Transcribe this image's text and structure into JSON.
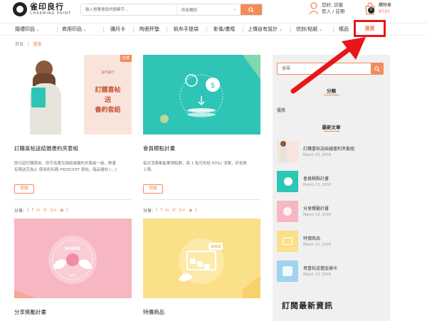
{
  "header": {
    "logo_cn": "雀印良行",
    "logo_en": "CHARMING PRINT",
    "search_placeholder": "輸入想要搜尋的關鍵字...",
    "category_select": "所有類別",
    "user_greeting": "您好, 訪客",
    "user_links": "登入 / 註冊",
    "cart_label": "購物車",
    "cart_price": "NT$0",
    "cart_count": "0"
  },
  "nav": {
    "items": [
      {
        "label": "婚禮印品",
        "caret": "⌄"
      },
      {
        "label": "商用印品",
        "caret": "⌄"
      },
      {
        "label": "彌月卡",
        "caret": ""
      },
      {
        "label": "陶瓷杯墊",
        "caret": ""
      },
      {
        "label": "帆布手提袋",
        "caret": ""
      },
      {
        "label": "影像/畫框",
        "caret": ""
      },
      {
        "label": "上傳自有設計",
        "caret": "⌄"
      },
      {
        "label": "信封/貼紙",
        "caret": "⌄"
      },
      {
        "label": "樣品",
        "caret": ""
      }
    ],
    "active": "優惠"
  },
  "breadcrumb": {
    "home": "首頁",
    "sep": "/",
    "current": "優惠"
  },
  "cards": [
    {
      "title": "訂購喜帖送結婚書約夾套組",
      "excerpt_1": "即日起訂購喜帖，即可免費兌換結婚書約夾套組一組，數量",
      "excerpt_2": "有限送完為止 使用折扣碼 FREECERT 喜帖，箱品書約 […]",
      "read": "閱讀",
      "share": "分享:",
      "img_tag": "好禮",
      "img_small": "雀印書行",
      "img_line1": "訂購喜帖",
      "img_line2": "送",
      "img_line3": "書約套組"
    },
    {
      "title": "會員積點計畫",
      "excerpt_1": "每次消費都能累積點數，每 1 點可折抵 NT$1 消費，折抵無",
      "excerpt_2": "上限。",
      "read": "閱讀",
      "share": "分享:"
    },
    {
      "title": "分享獎勵計畫",
      "img_text1": "SHARE",
      "img_text2": "GET"
    },
    {
      "title": "特價商品",
      "img_text1": "SALE"
    }
  ],
  "share_icons": [
    "twitter-icon",
    "facebook-icon",
    "linkedin-icon",
    "pinterest-icon",
    "google-plus-icon",
    "reddit-icon",
    "tumblr-icon"
  ],
  "share_glyphs": [
    "𝕥",
    "f",
    "in",
    "℗",
    "G+",
    "◉",
    "t"
  ],
  "sidebar": {
    "search_placeholder": "搜尋",
    "categories_heading": "分類",
    "category": "優惠",
    "recent_heading": "最新文章",
    "posts": [
      {
        "title": "訂購喜帖送結婚書約夾套組",
        "date": "March 13, 2016"
      },
      {
        "title": "會員積點計畫",
        "date": "March 13, 2016"
      },
      {
        "title": "分享獎勵計畫",
        "date": "March 13, 2016"
      },
      {
        "title": "特價商品",
        "date": "March 13, 2016"
      },
      {
        "title": "買喜帖送禮金謝卡",
        "date": "March 13, 2016"
      }
    ],
    "subscribe": "訂閱最新資訊"
  },
  "colors": {
    "accent": "#f28c5a",
    "highlight": "#e8161a",
    "teal": "#2ec4b6",
    "pink": "#f6b7c3",
    "yellow": "#fbe08a"
  }
}
